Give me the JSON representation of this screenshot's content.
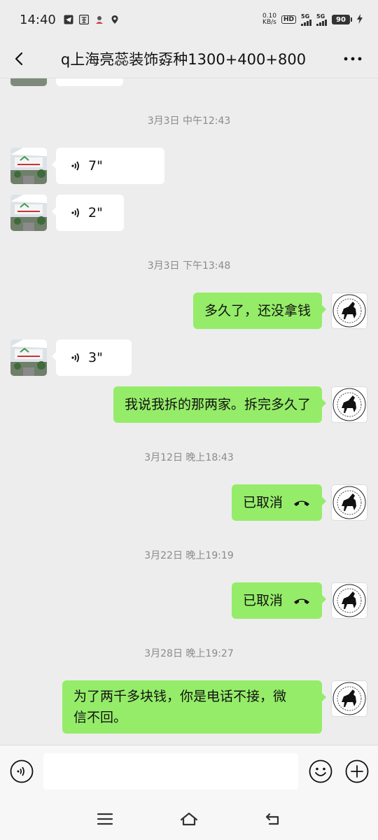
{
  "status_bar": {
    "time": "14:40",
    "net_speed_value": "0.10",
    "net_speed_unit": "KB/s",
    "hd_label": "HD",
    "sim1_label": "5G",
    "sim2_label": "5G",
    "battery": "90"
  },
  "header": {
    "title": "q上海亮蕊装饰孬种1300+400+800"
  },
  "messages": {
    "ts1": "3月3日 中午12:43",
    "voice1": "7\"",
    "voice2": "2\"",
    "ts2": "3月3日 下午13:48",
    "text1": "多久了，还没拿钱",
    "voice3": "3\"",
    "text2": "我说我拆的那两家。拆完多久了",
    "ts3": "3月12日 晚上18:43",
    "call1": "已取消",
    "ts4": "3月22日 晚上19:19",
    "call2": "已取消",
    "ts5": "3月28日 晚上19:27",
    "text3_line1": "为了两千多块钱，你是电话不接，微",
    "text3_line2": "信不回。"
  },
  "input": {
    "placeholder": ""
  },
  "colors": {
    "background": "#ededed",
    "sent_bubble": "#95ec69",
    "received_bubble": "#ffffff",
    "timestamp": "#8a8a8a"
  },
  "icons": {
    "back": "back-arrow-icon",
    "more": "more-dots-icon",
    "voice_mode": "voice-mode-icon",
    "emoji": "emoji-icon",
    "plus": "plus-icon",
    "call": "call-cancelled-icon"
  }
}
